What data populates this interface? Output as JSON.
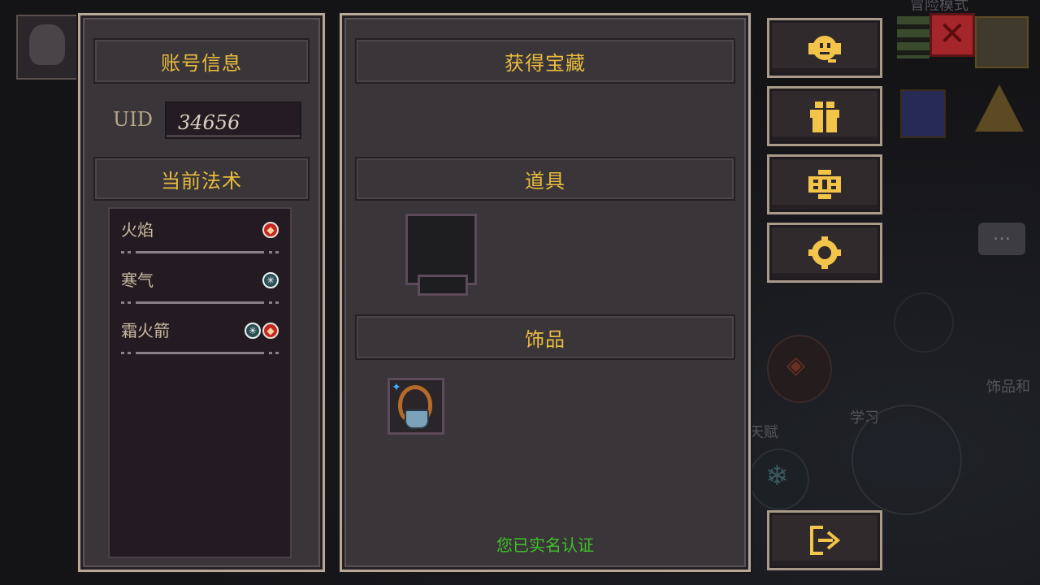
{
  "account_panel": {
    "title": "账号信息",
    "uid_label": "UID",
    "uid_value": "34656",
    "spells_title": "当前法术",
    "spells": [
      {
        "name": "火焰",
        "elements": [
          "fire"
        ]
      },
      {
        "name": "寒气",
        "elements": [
          "ice"
        ]
      },
      {
        "name": "霜火箭",
        "elements": [
          "ice",
          "fire"
        ]
      }
    ]
  },
  "treasure_panel": {
    "title": "获得宝藏",
    "items_title": "道具",
    "accessories_title": "饰品",
    "accessory_icon": "necklace-icon",
    "verified_text": "您已实名认证"
  },
  "side_buttons": [
    {
      "icon": "support-headset-icon"
    },
    {
      "icon": "gift-icon"
    },
    {
      "icon": "code-badge-icon"
    },
    {
      "icon": "settings-gear-icon"
    },
    {
      "icon": "logout-icon"
    }
  ],
  "background": {
    "adventure_mode_text": "冒险模式",
    "accessory_hint_text": "饰品和",
    "talent_text": "天赋",
    "learn_text": "学习"
  },
  "colors": {
    "header_text": "#e8bc3e",
    "verified_text": "#3ec22a",
    "fire": "#c2271f",
    "ice": "#2b4f55",
    "panel_border": "#b7a898"
  }
}
